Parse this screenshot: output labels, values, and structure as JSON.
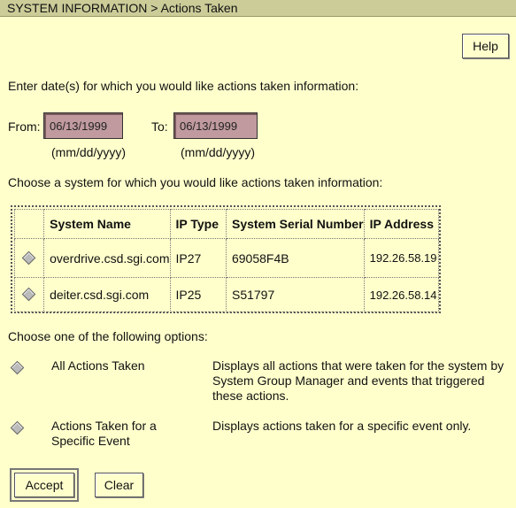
{
  "header": {
    "title": "SYSTEM INFORMATION > Actions Taken"
  },
  "help_label": "Help",
  "date_prompt": "Enter date(s) for which you would like actions taken information:",
  "from": {
    "label": "From:",
    "value": "06/13/1999",
    "hint": "(mm/dd/yyyy)"
  },
  "to": {
    "label": "To:",
    "value": "06/13/1999",
    "hint": "(mm/dd/yyyy)"
  },
  "system_prompt": "Choose a system for which you would like actions taken information:",
  "table": {
    "headers": [
      "System Name",
      "IP Type",
      "System Serial Number",
      "IP Address"
    ],
    "rows": [
      [
        "overdrive.csd.sgi.com",
        "IP27",
        "69058F4B",
        "192.26.58.19"
      ],
      [
        "deiter.csd.sgi.com",
        "IP25",
        "S51797",
        "192.26.58.14"
      ]
    ]
  },
  "options_prompt": "Choose one of the following options:",
  "options": [
    {
      "label": "All Actions Taken",
      "description": "Displays all actions that were taken for the system by System Group Manager and events that triggered these actions."
    },
    {
      "label": "Actions Taken for a Specific Event",
      "description": "Displays actions taken for a specific event only."
    }
  ],
  "accept_label": "Accept",
  "clear_label": "Clear"
}
